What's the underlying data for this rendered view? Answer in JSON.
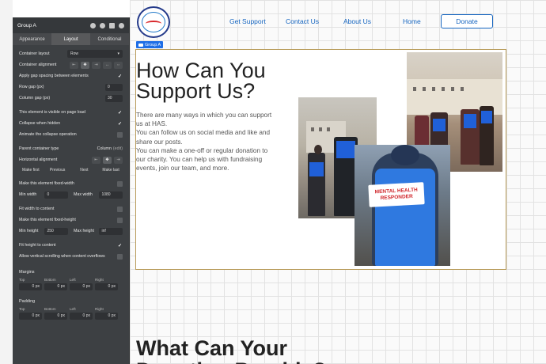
{
  "editor": {
    "title": "Group A",
    "tabs": [
      "Appearance",
      "Layout",
      "Conditional"
    ],
    "active_tab": "Layout",
    "container_layout_label": "Container layout",
    "container_layout_value": "Row",
    "container_alignment_label": "Container alignment",
    "apply_gap_label": "Apply gap spacing between elements",
    "row_gap_label": "Row gap (px)",
    "row_gap_value": "0",
    "column_gap_label": "Column gap (px)",
    "column_gap_value": "30",
    "visible_on_load_label": "This element is visible on page load",
    "collapse_hidden_label": "Collapse when hidden",
    "animate_collapse_label": "Animate the collapse operation",
    "parent_type_label": "Parent container type",
    "parent_type_value": "Column",
    "parent_type_edit": "(edit)",
    "horizontal_alignment_label": "Horizontal alignment",
    "order_options": [
      "Make first",
      "Previous",
      "Next",
      "Make last"
    ],
    "fixed_width_label": "Make this element fixed-width",
    "min_width_label": "Min width",
    "min_width_value": "0",
    "max_width_label": "Max width",
    "max_width_value": "1080",
    "fit_width_label": "Fit width to content",
    "fixed_height_label": "Make this element fixed-height",
    "min_height_label": "Min height",
    "min_height_value": "250",
    "max_height_label": "Max height",
    "max_height_value": "inf",
    "fit_height_label": "Fit height to content",
    "vertical_scroll_label": "Allow vertical scrolling when content overflows",
    "margins_label": "Margins",
    "padding_label": "Padding",
    "side_labels": [
      "Top",
      "Bottom",
      "Left",
      "Right"
    ],
    "side_value": "0 px"
  },
  "site": {
    "nav": [
      "Get Support",
      "Contact Us",
      "About Us",
      "Home"
    ],
    "donate_label": "Donate",
    "group_badge": "Group A",
    "hero_title": "How Can You Support Us?",
    "hero_paragraphs": [
      "There are many ways in which you can support us at HAS.",
      "You can follow us on social media and like and share our posts.",
      "You can make a one-off or regular donation to our charity. You can help us with fundraising events, join our team, and more."
    ],
    "vest_patch_line1": "MENTAL HEALTH",
    "vest_patch_line2": "RESPONDER",
    "next_section_title": "What Can Your Donation Provide?"
  },
  "colors": {
    "nav_link": "#1565c0",
    "group_outline": "#b79a58",
    "editor_bg": "#3d4043",
    "selection_blue": "#1e6ee6"
  }
}
